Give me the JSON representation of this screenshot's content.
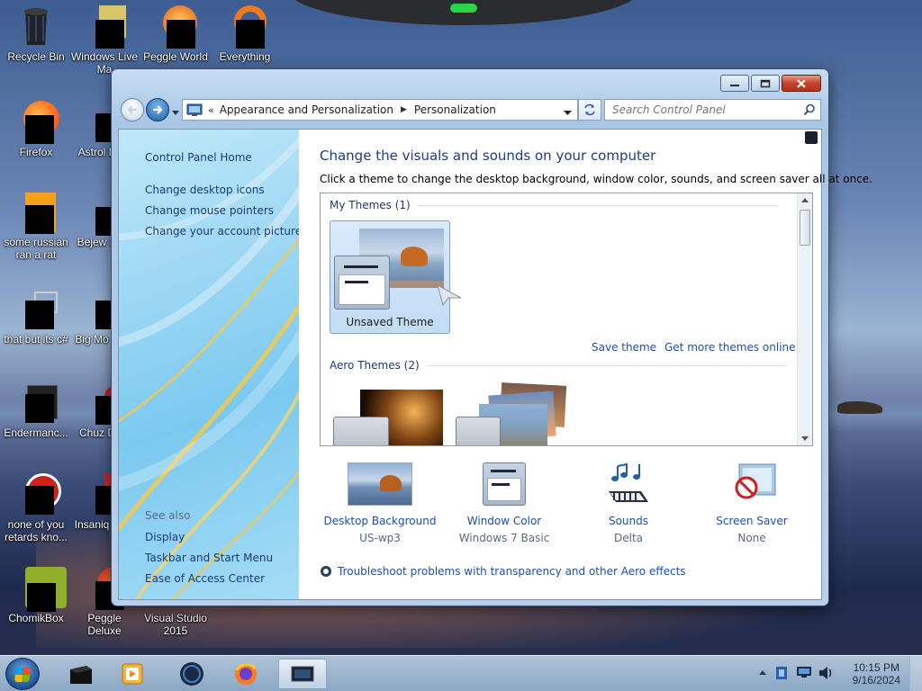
{
  "desktop": {
    "icons": [
      {
        "label": "Recycle Bin"
      },
      {
        "label": "Windows Live Ma"
      },
      {
        "label": "Peggle World"
      },
      {
        "label": "Everything"
      },
      {
        "label": "Firefox"
      },
      {
        "label": "Astrol Delu"
      },
      {
        "label": "some russian ran a rat"
      },
      {
        "label": "Bejew Delu"
      },
      {
        "label": "that but its c#"
      },
      {
        "label": "Big Mo Delu"
      },
      {
        "label": "Endermanc..."
      },
      {
        "label": "Chuz Delu"
      },
      {
        "label": "none of you retards kno..."
      },
      {
        "label": "Insaniq Delu"
      },
      {
        "label": "ChomikBox"
      },
      {
        "label": "Peggle Deluxe"
      },
      {
        "label": "Visual Studio 2015"
      }
    ]
  },
  "window": {
    "address": {
      "segments": [
        "Appearance and Personalization",
        "Personalization"
      ]
    },
    "search": {
      "placeholder": "Search Control Panel"
    },
    "left_pane": {
      "home": "Control Panel Home",
      "links": [
        "Change desktop icons",
        "Change mouse pointers",
        "Change your account picture"
      ],
      "see_also_heading": "See also",
      "see_also": [
        "Display",
        "Taskbar and Start Menu",
        "Ease of Access Center"
      ]
    },
    "content": {
      "title": "Change the visuals and sounds on your computer",
      "description": "Click a theme to change the desktop background, window color, sounds, and screen saver all at once.",
      "my_themes_header": "My Themes (1)",
      "unsaved_theme_label": "Unsaved Theme",
      "save_theme": "Save theme",
      "get_more_themes": "Get more themes online",
      "aero_themes_header": "Aero Themes (2)",
      "bottom": [
        {
          "label": "Desktop Background",
          "value": "US-wp3"
        },
        {
          "label": "Window Color",
          "value": "Windows 7 Basic"
        },
        {
          "label": "Sounds",
          "value": "Delta"
        },
        {
          "label": "Screen Saver",
          "value": "None"
        }
      ],
      "troubleshoot": "Troubleshoot problems with transparency and other Aero effects"
    }
  },
  "taskbar": {
    "time": "10:15 PM",
    "date": "9/16/2024"
  },
  "colors": {
    "link": "#1e4fb0",
    "title": "#1e3b8a",
    "close_button": "#c2452c"
  }
}
